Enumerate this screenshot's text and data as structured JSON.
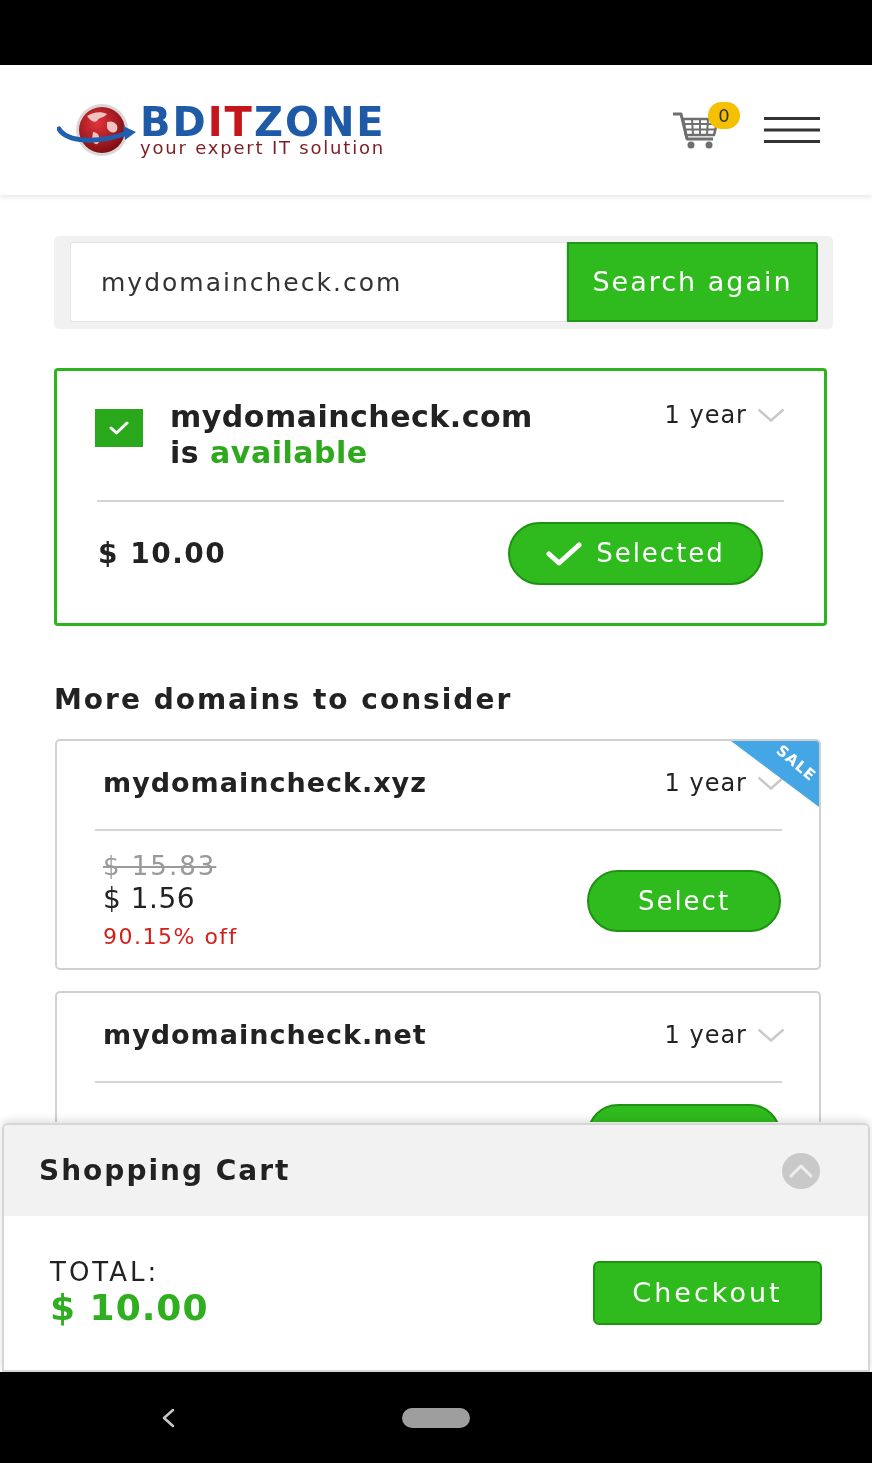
{
  "header": {
    "logo": {
      "wordmark": [
        {
          "text": "BD",
          "kind": "plain"
        },
        {
          "text": "IT",
          "kind": "accent"
        },
        {
          "text": "ZONE",
          "kind": "plain"
        }
      ],
      "tagline": "your expert IT solution"
    },
    "cart_count": "0"
  },
  "search": {
    "value": "mydomaincheck.com",
    "button": "Search again"
  },
  "result": {
    "checked": true,
    "domain": "mydomaincheck.com",
    "status_prefix": "is",
    "status": "available",
    "term": "1 year",
    "price": "$ 10.00",
    "button": "Selected",
    "selected": true
  },
  "suggestions_title": "More domains to consider",
  "suggestions": [
    {
      "domain": "mydomaincheck.xyz",
      "term": "1 year",
      "badge": "SALE",
      "old_price": "$ 15.83",
      "price": "$ 1.56",
      "discount": "90.15% off",
      "button": "Select",
      "selected": false
    },
    {
      "domain": "mydomaincheck.net",
      "term": "1 year",
      "selected": false
    }
  ],
  "cart": {
    "title": "Shopping Cart",
    "total_label": "TOTAL:",
    "total": "$ 10.00",
    "button": "Checkout"
  }
}
